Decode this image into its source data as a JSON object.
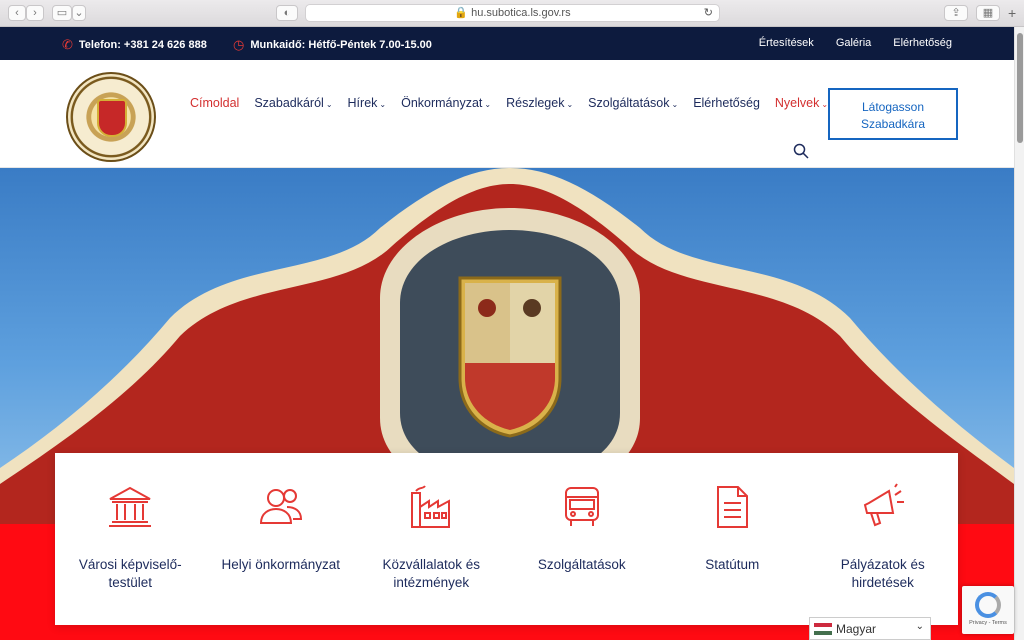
{
  "browser": {
    "url": "hu.subotica.ls.gov.rs",
    "tabs_icon": "tabs-icon"
  },
  "topbar": {
    "phone": "Telefon: +381 24 626 888",
    "hours": "Munkaidő: Hétfő-Péntek 7.00-15.00",
    "links": [
      "Értesítések",
      "Galéria",
      "Elérhetőség"
    ]
  },
  "nav": {
    "items": [
      {
        "label": "Címoldal",
        "dropdown": false
      },
      {
        "label": "Szabadkáról",
        "dropdown": true
      },
      {
        "label": "Hírek",
        "dropdown": true
      },
      {
        "label": "Önkormányzat",
        "dropdown": true
      },
      {
        "label": "Részlegek",
        "dropdown": true
      },
      {
        "label": "Szolgáltatások",
        "dropdown": true
      },
      {
        "label": "Elérhetőség",
        "dropdown": false
      },
      {
        "label": "Nyelvek",
        "dropdown": true
      }
    ],
    "visit_button_line1": "Látogasson",
    "visit_button_line2": "Szabadkára"
  },
  "cards": [
    {
      "icon": "city-hall-icon",
      "line1": "Városi képviselő-",
      "line2": "testület"
    },
    {
      "icon": "people-icon",
      "line1": "Helyi önkormányzat",
      "line2": ""
    },
    {
      "icon": "factory-icon",
      "line1": "Közvállalatok és",
      "line2": "intézmények"
    },
    {
      "icon": "bus-icon",
      "line1": "Szolgáltatások",
      "line2": ""
    },
    {
      "icon": "document-icon",
      "line1": "Statútum",
      "line2": ""
    },
    {
      "icon": "megaphone-icon",
      "line1": "Pályázatok és",
      "line2": "hirdetések"
    }
  ],
  "language": {
    "selected": "Magyar"
  },
  "recaptcha": {
    "text": "Privacy - Terms"
  },
  "colors": {
    "navy": "#0d1b3e",
    "accent_red": "#d32f2f",
    "button_blue": "#1565c0"
  }
}
